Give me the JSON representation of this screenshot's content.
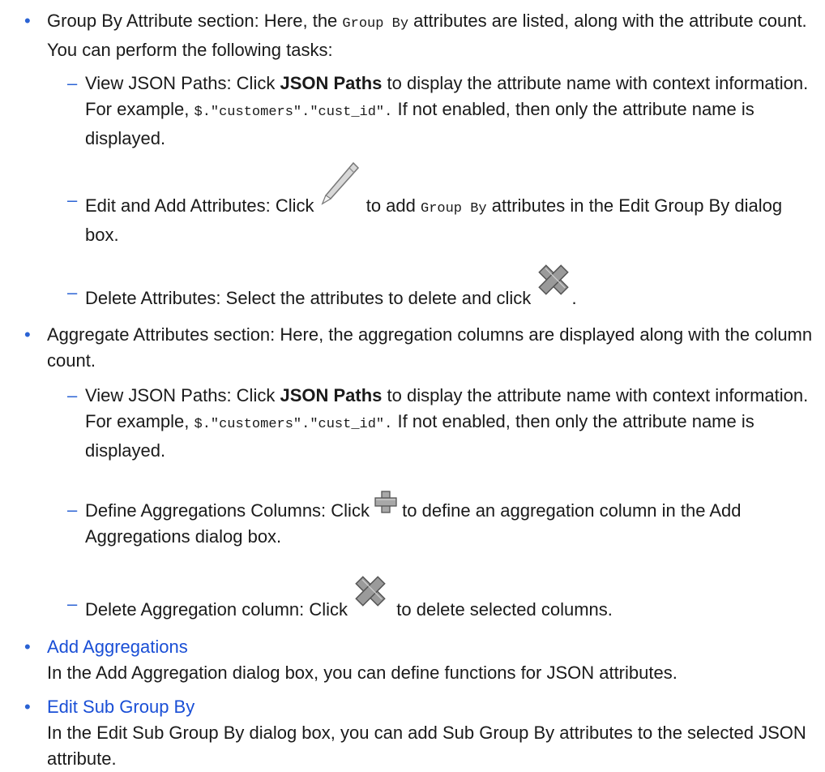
{
  "groupby": {
    "a": "Group By Attribute section: Here, the ",
    "code": "Group By",
    "b": " attributes are listed, along with the attribute count. You can perform the following tasks:"
  },
  "gb_view": {
    "a": "View JSON Paths: Click ",
    "bold": "JSON Paths",
    "b": " to display the attribute name with context information. For example, ",
    "code": "$.\"customers\".\"cust_id\".",
    "c": " If not enabled, then only the attribute name is displayed."
  },
  "gb_edit": {
    "a": "Edit and Add Attributes: Click ",
    "b": " to add ",
    "code": "Group By",
    "c": " attributes in the Edit Group By dialog box."
  },
  "gb_delete": {
    "a": "Delete Attributes: Select the attributes to delete and click ",
    "b": "."
  },
  "agg": {
    "text": "Aggregate Attributes section: Here, the aggregation columns are displayed along with the column count."
  },
  "agg_view": {
    "a": "View JSON Paths: Click ",
    "bold": "JSON Paths",
    "b": " to display the attribute name with context information. For example, ",
    "code": "$.\"customers\".\"cust_id\".",
    "c": " If not enabled, then only the attribute name is displayed."
  },
  "agg_define": {
    "a": "Define Aggregations Columns: Click ",
    "b": " to define an aggregation column in the Add Aggregations dialog box."
  },
  "agg_delete": {
    "a": "Delete Aggregation column: Click ",
    "b": " to delete selected columns."
  },
  "add_agg": {
    "link": "Add Aggregations",
    "desc": "In the Add Aggregation dialog box, you can define functions for JSON attributes."
  },
  "sub_group": {
    "link": "Edit Sub Group By",
    "desc": "In the Edit Sub Group By dialog box, you can add Sub Group By attributes to the selected JSON attribute."
  },
  "icons": {
    "edit": "pencil-icon",
    "delete": "x-delete-icon",
    "add": "plus-add-icon"
  },
  "colors": {
    "bullet": "#2b63d4",
    "link": "#1a4fd6"
  }
}
